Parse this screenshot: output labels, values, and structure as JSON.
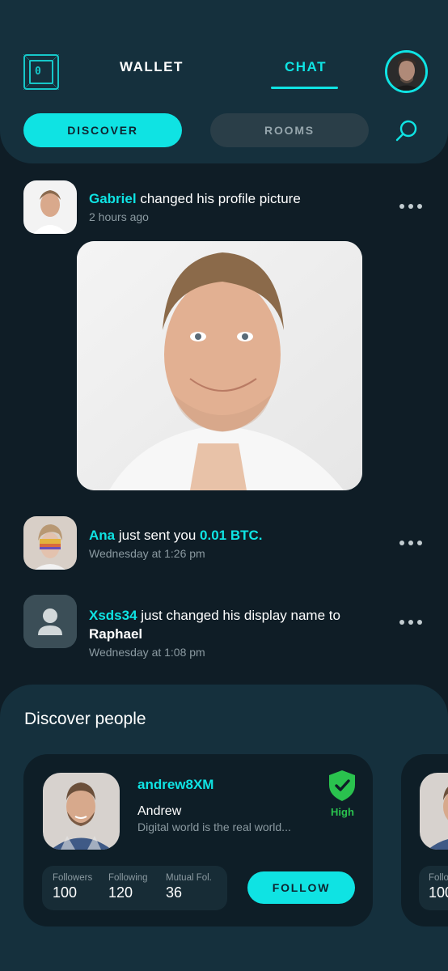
{
  "header": {
    "logo_char": "0",
    "tabs": [
      {
        "label": "WALLET",
        "active": false
      },
      {
        "label": "CHAT",
        "active": true
      }
    ],
    "filters": [
      {
        "label": "DISCOVER",
        "active": true
      },
      {
        "label": "ROOMS",
        "active": false
      }
    ],
    "icons": {
      "search": "search-icon",
      "avatar": "user-avatar"
    }
  },
  "feed": [
    {
      "name": "Gabriel",
      "text": "changed his profile picture",
      "time": "2 hours ago"
    },
    {
      "name": "Ana",
      "text": "just sent you",
      "amount": "0.01 BTC.",
      "time": "Wednesday at 1:26 pm"
    },
    {
      "name": "Xsds34",
      "text": "just changed his display name to",
      "new_name": "Raphael",
      "time": "Wednesday at 1:08 pm"
    }
  ],
  "discover": {
    "title": "Discover people",
    "card": {
      "username": "andrew8XM",
      "name": "Andrew",
      "bio": "Digital world is the real world...",
      "trust_label": "High",
      "stats": [
        {
          "label": "Followers",
          "value": "100"
        },
        {
          "label": "Following",
          "value": "120"
        },
        {
          "label": "Mutual Fol.",
          "value": "36"
        }
      ],
      "follow_label": "FOLLOW"
    },
    "peek": {
      "stat_label": "Follo",
      "stat_value": "100"
    }
  },
  "colors": {
    "accent": "#0fe3e3",
    "background": "#0f1d26",
    "panel": "#15303d",
    "trust": "#2ac24e"
  }
}
